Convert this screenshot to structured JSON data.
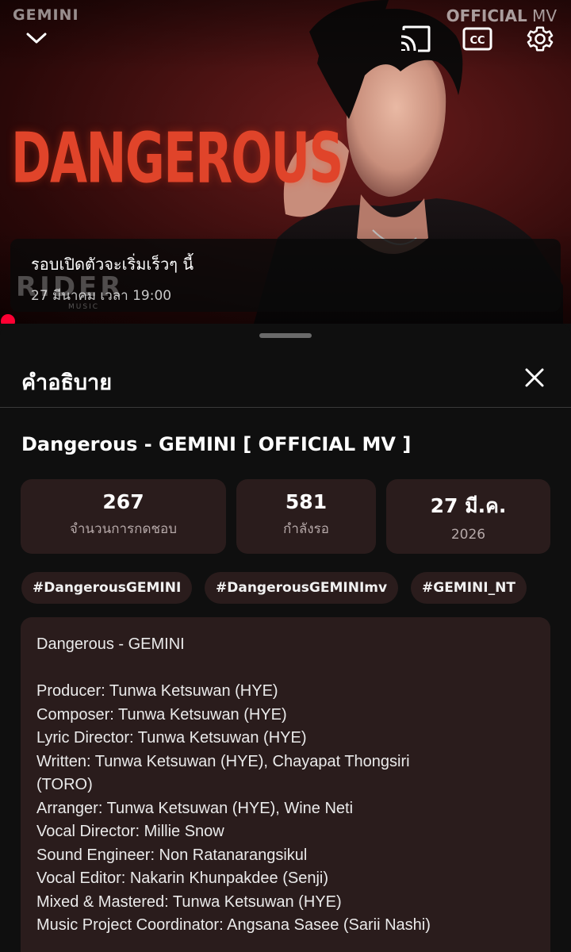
{
  "player": {
    "brand_left": "GEMINI",
    "brand_right_bold": "OFFICIAL",
    "brand_right_rest": " MV",
    "cover_title": "DANGEROUS",
    "label_logo": "RIDER",
    "label_logo_sub": "MUSIC",
    "premiere_title": "รอบเปิดตัวจะเริ่มเร็วๆ นี้",
    "premiere_time": "27 มีนาคม เวลา 19:00",
    "icons": [
      "chevron-down-icon",
      "cast-icon",
      "captions-icon",
      "settings-gear-icon"
    ],
    "progress_color": "#ff0033"
  },
  "sheet": {
    "title": "คำอธิบาย",
    "video_title": "Dangerous - GEMINI  [ OFFICIAL MV ]",
    "stats": [
      {
        "value": "267",
        "label": "จำนวนการกดชอบ"
      },
      {
        "value": "581",
        "label": "กำลังรอ"
      },
      {
        "value": "27 มี.ค.",
        "label": "2026"
      }
    ],
    "tags": [
      "#DangerousGEMINI",
      "#DangerousGEMINImv",
      "#GEMINI_NT"
    ],
    "description": {
      "heading": "Dangerous - GEMINI",
      "lines": [
        "Producer: Tunwa Ketsuwan (HYE)",
        "Composer: Tunwa Ketsuwan (HYE)",
        "Lyric Director: Tunwa Ketsuwan (HYE)",
        "Written: Tunwa Ketsuwan (HYE), Chayapat Thongsiri",
        "(TORO)",
        "Arranger: Tunwa Ketsuwan (HYE), Wine Neti",
        "Vocal Director: Millie Snow",
        "Sound Engineer: Non Ratanarangsikul",
        "Vocal Editor: Nakarin Khunpakdee (Senji)",
        "Mixed & Mastered: Tunwa Ketsuwan (HYE)",
        "Music Project Coordinator: Angsana Sasee (Sarii Nashi)"
      ]
    }
  },
  "colors": {
    "sheet_bg": "#0f0f0f",
    "card_bg": "#2a1c1c",
    "accent_red": "#e0442a"
  }
}
